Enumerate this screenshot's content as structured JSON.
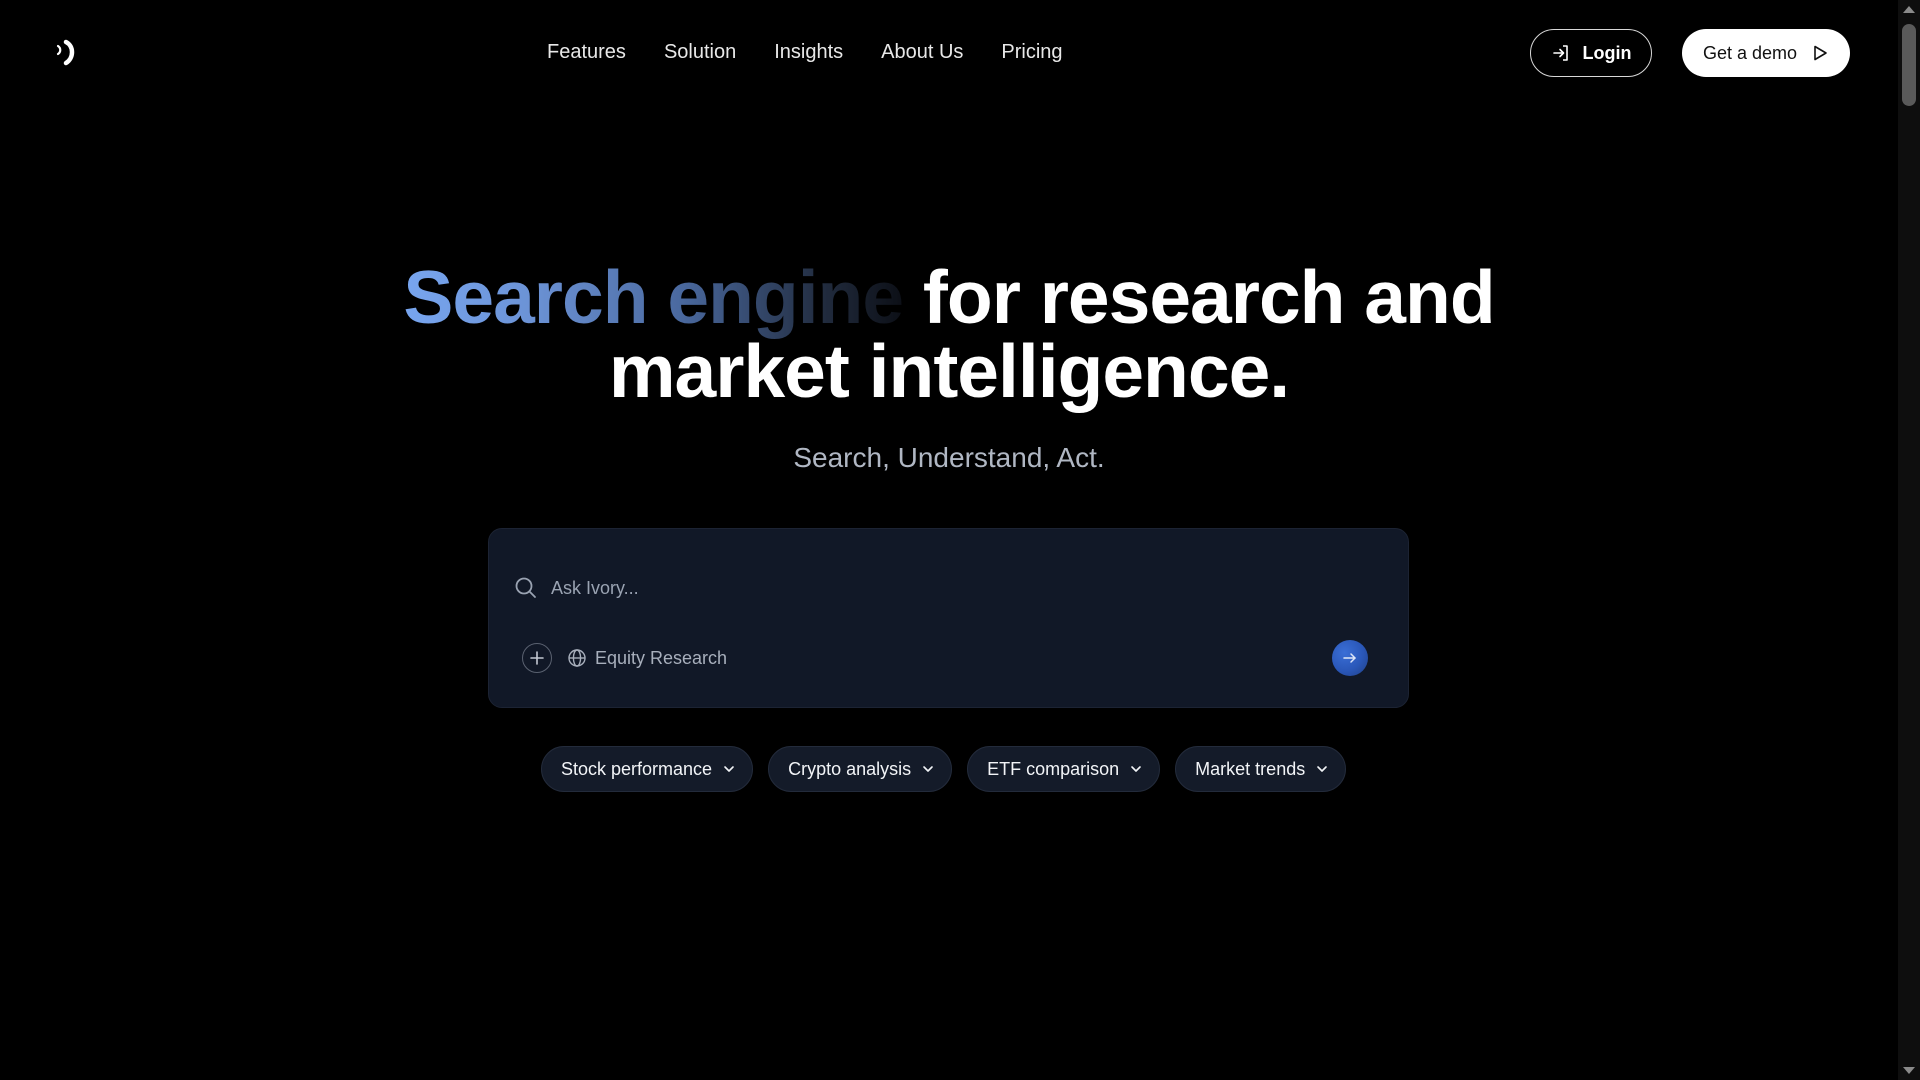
{
  "header": {
    "logo_icon": "ivory-logo-icon",
    "nav": [
      "Features",
      "Solution",
      "Insights",
      "About Us",
      "Pricing"
    ],
    "login_label": "Login",
    "login_icon": "login-arrow-icon",
    "demo_label": "Get a demo",
    "demo_icon": "play-icon"
  },
  "hero": {
    "title_gradient": "Search engine",
    "title_rest_line1": "for research and",
    "title_line2": "market intelligence.",
    "subtitle": "Search, Understand, Act."
  },
  "search": {
    "placeholder": "Ask Ivory...",
    "value": "",
    "add_icon": "plus-icon",
    "mode_icon": "globe-icon",
    "mode_label": "Equity Research",
    "send_icon": "arrow-right-icon"
  },
  "suggestions": [
    "Stock performance",
    "Crypto analysis",
    "ETF comparison",
    "Market trends"
  ],
  "colors": {
    "background": "#000000",
    "card": "#111827",
    "accent": "#78a6f0",
    "send_button": "#2a57b8"
  }
}
